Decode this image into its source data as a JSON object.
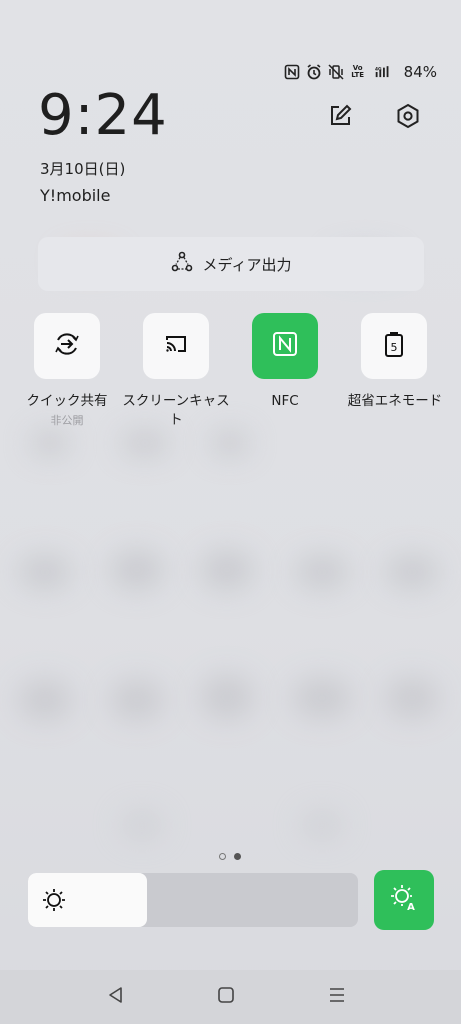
{
  "status_bar": {
    "icons": [
      "nfc-icon",
      "alarm-icon",
      "vibrate-off-icon",
      "volte-icon",
      "4g-signal-icon"
    ],
    "battery": "84%"
  },
  "header": {
    "time": "9:24",
    "date": "3月10日(日)",
    "carrier": "Y!mobile",
    "edit_icon": "edit-icon",
    "settings_icon": "gear-icon"
  },
  "media_output": {
    "label": "メディア出力",
    "icon": "media-output-icon"
  },
  "tiles": [
    {
      "label": "クイック共有",
      "sub": "非公開",
      "icon": "quick-share-icon",
      "active": false
    },
    {
      "label": "スクリーンキャスト",
      "sub": "",
      "icon": "cast-icon",
      "active": false
    },
    {
      "label": "NFC",
      "sub": "",
      "icon": "nfc-icon",
      "active": true
    },
    {
      "label": "超省エネモード",
      "sub": "",
      "icon": "battery-saver-icon",
      "active": false
    }
  ],
  "pager": {
    "pages": 2,
    "current": 2
  },
  "brightness": {
    "level": 0.36,
    "icon": "brightness-icon",
    "auto_icon": "auto-brightness-icon"
  },
  "colors": {
    "accent": "#2fbf5a",
    "background": "#e1e2e6"
  },
  "nav": {
    "back_icon": "back-icon",
    "home_icon": "home-icon",
    "recents_icon": "recents-icon"
  }
}
